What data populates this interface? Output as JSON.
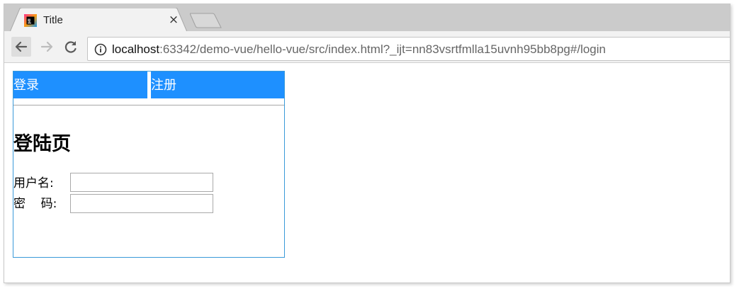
{
  "browser": {
    "tab": {
      "title": "Title",
      "close_glyph": "×",
      "favicon": "webstorm-icon"
    },
    "toolbar": {
      "back": "back-arrow-icon",
      "forward": "forward-arrow-icon",
      "reload": "reload-icon",
      "info": "info-icon"
    },
    "address": {
      "host": "localhost",
      "rest": ":63342/demo-vue/hello-vue/src/index.html?_ijt=nn83vsrtfmlla15uvnh95bb8pg#/login"
    }
  },
  "page": {
    "nav": {
      "login_label": "登录",
      "register_label": "注册"
    },
    "title": "登陆页",
    "form": {
      "username_label": "用户名:",
      "username_value": "",
      "password_label": "密    码:",
      "password_value": ""
    }
  },
  "colors": {
    "nav_bg": "#1e90ff",
    "app_border": "#3a9ad9",
    "tabstrip": "#cbcbcb",
    "toolbar": "#f2f2f2"
  }
}
